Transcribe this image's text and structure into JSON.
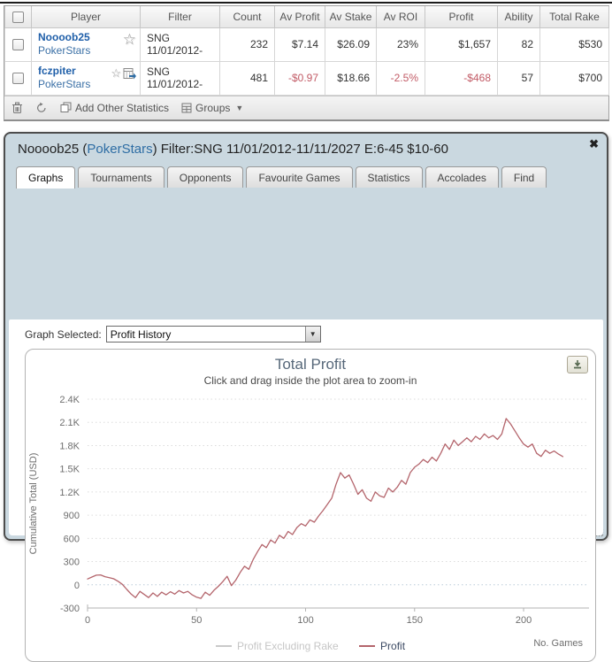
{
  "table": {
    "columns": [
      "Player",
      "Filter",
      "Count",
      "Av Profit",
      "Av Stake",
      "Av ROI",
      "Profit",
      "Ability",
      "Total Rake"
    ],
    "rows": [
      {
        "player": "Noooob25",
        "site": "PokerStars",
        "filter": "SNG 11/01/2012-",
        "count": "232",
        "av_profit": "$7.14",
        "av_stake": "$26.09",
        "av_roi": "23%",
        "profit": "$1,657",
        "ability": "82",
        "total_rake": "$530"
      },
      {
        "player": "fczpiter",
        "site": "PokerStars",
        "filter": "SNG 11/01/2012-",
        "count": "481",
        "av_profit": "-$0.97",
        "av_stake": "$18.66",
        "av_roi": "-2.5%",
        "profit": "-$468",
        "ability": "57",
        "total_rake": "$700"
      }
    ],
    "toolbar": {
      "add_other_statistics": "Add Other Statistics",
      "groups": "Groups"
    }
  },
  "popup": {
    "title_prefix": "Noooob25 (",
    "title_site": "PokerStars",
    "title_suffix": ") Filter:SNG 11/01/2012-11/11/2027 E:6-45 $10-60",
    "close_glyph": "✖",
    "tabs": [
      "Graphs",
      "Tournaments",
      "Opponents",
      "Favourite Games",
      "Statistics",
      "Accolades",
      "Find"
    ],
    "active_tab": "Graphs",
    "graph_selected_label": "Graph Selected:",
    "graph_selected_value": "Profit History"
  },
  "colors": {
    "profit_line": "#b4656c",
    "disabled_series": "#c9c9c9",
    "negative_value": "#c25b66",
    "link_blue": "#1f5fa9",
    "popup_bg": "#cad8e0"
  },
  "chart_data": {
    "type": "line",
    "title": "Total Profit",
    "subtitle": "Click and drag inside the plot area to zoom-in",
    "xlabel": "No. Games",
    "ylabel": "Cumulative Total (USD)",
    "xlim": [
      0,
      230
    ],
    "ylim": [
      -300,
      2400
    ],
    "xticks": [
      0,
      50,
      100,
      150,
      200
    ],
    "yticks": [
      -300,
      0,
      300,
      600,
      900,
      1200,
      1500,
      1800,
      2100,
      2400
    ],
    "ytick_labels": [
      "-300",
      "0",
      "300",
      "600",
      "900",
      "1.2K",
      "1.5K",
      "1.8K",
      "2.1K",
      "2.4K"
    ],
    "grid": "horizontal-dotted",
    "legend_position": "bottom",
    "legend": [
      {
        "name": "Profit Excluding Rake",
        "color": "#c9c9c9",
        "enabled": false
      },
      {
        "name": "Profit",
        "color": "#b4656c",
        "enabled": true
      }
    ],
    "series": [
      {
        "name": "Profit",
        "color": "#b4656c",
        "x": [
          0,
          2,
          4,
          6,
          8,
          10,
          12,
          14,
          16,
          18,
          20,
          22,
          24,
          26,
          28,
          30,
          32,
          34,
          36,
          38,
          40,
          42,
          44,
          46,
          48,
          50,
          52,
          54,
          56,
          58,
          60,
          62,
          64,
          66,
          68,
          70,
          72,
          74,
          76,
          78,
          80,
          82,
          84,
          86,
          88,
          90,
          92,
          94,
          96,
          98,
          100,
          102,
          104,
          106,
          108,
          110,
          112,
          114,
          116,
          118,
          120,
          122,
          124,
          126,
          128,
          130,
          132,
          134,
          136,
          138,
          140,
          142,
          144,
          146,
          148,
          150,
          152,
          154,
          156,
          158,
          160,
          162,
          164,
          166,
          168,
          170,
          172,
          174,
          176,
          178,
          180,
          182,
          184,
          186,
          188,
          190,
          192,
          194,
          196,
          198,
          200,
          202,
          204,
          206,
          208,
          210,
          212,
          214,
          216,
          218
        ],
        "y": [
          75,
          100,
          125,
          128,
          105,
          92,
          78,
          45,
          5,
          -60,
          -120,
          -165,
          -85,
          -125,
          -165,
          -105,
          -150,
          -95,
          -130,
          -90,
          -120,
          -75,
          -105,
          -85,
          -130,
          -160,
          -175,
          -95,
          -135,
          -70,
          -20,
          40,
          110,
          -10,
          60,
          160,
          240,
          200,
          330,
          430,
          520,
          480,
          580,
          540,
          640,
          600,
          690,
          650,
          740,
          790,
          760,
          840,
          810,
          890,
          960,
          1040,
          1120,
          1300,
          1450,
          1380,
          1420,
          1300,
          1170,
          1230,
          1120,
          1080,
          1200,
          1150,
          1130,
          1250,
          1200,
          1260,
          1350,
          1300,
          1450,
          1520,
          1560,
          1620,
          1580,
          1650,
          1600,
          1700,
          1820,
          1750,
          1870,
          1800,
          1850,
          1900,
          1850,
          1920,
          1880,
          1950,
          1900,
          1930,
          1880,
          1950,
          2150,
          2080,
          1990,
          1900,
          1820,
          1780,
          1820,
          1700,
          1660,
          1740,
          1700,
          1730,
          1690,
          1657
        ]
      }
    ]
  }
}
